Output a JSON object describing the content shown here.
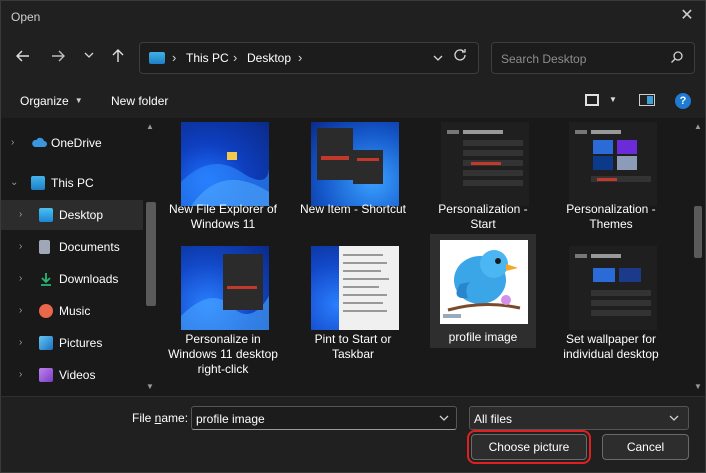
{
  "window": {
    "title": "Open",
    "close_glyph": "✕"
  },
  "nav": {
    "back_icon": "arrow-left",
    "forward_icon": "arrow-right",
    "recent_icon": "chevron-down",
    "up_icon": "arrow-up",
    "breadcrumb": [
      "This PC",
      "Desktop"
    ],
    "refresh_icon": "refresh",
    "search_placeholder": "Search Desktop"
  },
  "toolbar": {
    "organize_label": "Organize",
    "new_folder_label": "New folder"
  },
  "sidebar": {
    "items": [
      {
        "label": "OneDrive",
        "icon": "cloud-icon",
        "color": "#3a96dd"
      },
      {
        "label": "This PC",
        "icon": "computer-icon",
        "color": "#36a5e0"
      },
      {
        "label": "Desktop",
        "icon": "desktop-icon",
        "color": "#2ea6e8"
      },
      {
        "label": "Documents",
        "icon": "document-icon",
        "color": "#a0a8b8"
      },
      {
        "label": "Downloads",
        "icon": "download-icon",
        "color": "#2bb673"
      },
      {
        "label": "Music",
        "icon": "music-icon",
        "color": "#e9674a"
      },
      {
        "label": "Pictures",
        "icon": "pictures-icon",
        "color": "#3b9ee0"
      },
      {
        "label": "Videos",
        "icon": "videos-icon",
        "color": "#9b55d3"
      }
    ]
  },
  "files": [
    {
      "name": "New File Explorer of Windows 11",
      "thumb": "win11-blue-bloom"
    },
    {
      "name": "New Item - Shortcut",
      "thumb": "context-menu"
    },
    {
      "name": "Personalization - Start",
      "thumb": "settings-dark"
    },
    {
      "name": "Personalization - Themes",
      "thumb": "settings-themes"
    },
    {
      "name": "Personalize in Windows 11 desktop right-click",
      "thumb": "win11-context"
    },
    {
      "name": "Pint to Start or Taskbar",
      "thumb": "long-menu"
    },
    {
      "name": "profile image",
      "thumb": "blue-bird"
    },
    {
      "name": "Set wallpaper for individual desktop",
      "thumb": "wallpaper-settings"
    }
  ],
  "bottom": {
    "file_name_label_prefix": "File ",
    "file_name_label_underlined": "n",
    "file_name_label_suffix": "ame:",
    "file_name_value": "profile image",
    "file_type_value": "All files",
    "choose_button": "Choose picture",
    "cancel_button": "Cancel",
    "highlight_color": "#e02020"
  }
}
